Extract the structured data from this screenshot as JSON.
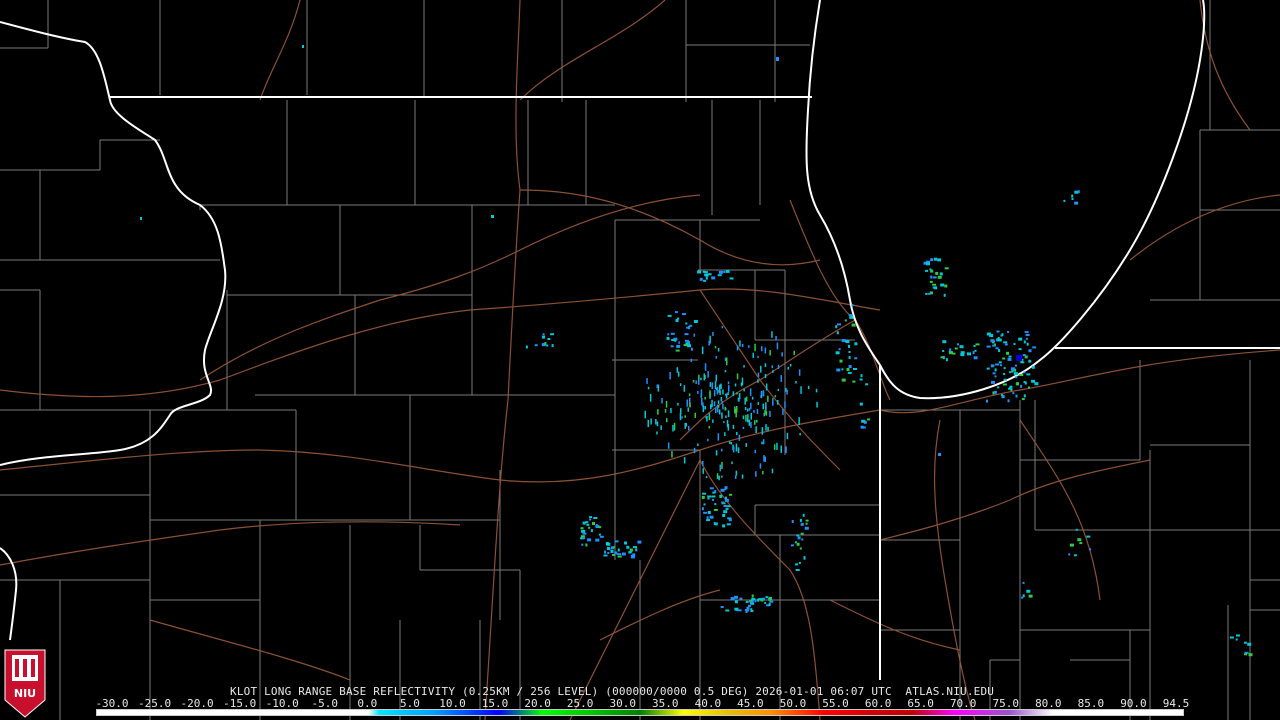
{
  "product_line": "KLOT LONG RANGE BASE REFLECTIVITY (0.25KM / 256 LEVEL) (000000/0000 0.5 DEG) 2026-01-01 06:07 UTC  ATLAS.NIU.EDU",
  "scale_labels": [
    "-30.0",
    "-25.0",
    "-20.0",
    "-15.0",
    "-10.0",
    "-5.0",
    "0.0",
    "5.0",
    "10.0",
    "15.0",
    "20.0",
    "25.0",
    "30.0",
    "35.0",
    "40.0",
    "45.0",
    "50.0",
    "55.0",
    "60.0",
    "65.0",
    "70.0",
    "75.0",
    "80.0",
    "85.0",
    "90.0",
    "94.5"
  ],
  "logo": {
    "text": "NIU",
    "color": "#c8102e"
  },
  "colors": {
    "background": "#000000",
    "state_lines": "#ffffff",
    "county_lines": "#7f7f7f",
    "roads": "#a0522d",
    "echo_light": "#00c8d8",
    "echo_mid": "#1e90ff",
    "echo_strong": "#0000e0",
    "echo_green": "#2ecc40"
  }
}
